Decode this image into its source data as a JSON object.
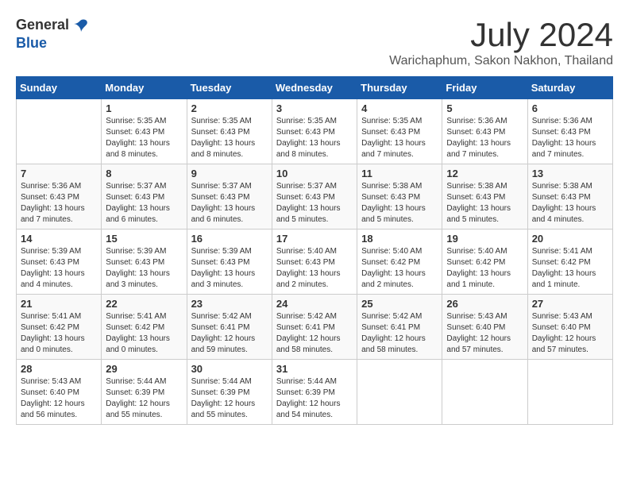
{
  "header": {
    "logo_line1": "General",
    "logo_line2": "Blue",
    "month": "July 2024",
    "location": "Warichaphum, Sakon Nakhon, Thailand"
  },
  "weekdays": [
    "Sunday",
    "Monday",
    "Tuesday",
    "Wednesday",
    "Thursday",
    "Friday",
    "Saturday"
  ],
  "weeks": [
    [
      {
        "day": "",
        "info": ""
      },
      {
        "day": "1",
        "info": "Sunrise: 5:35 AM\nSunset: 6:43 PM\nDaylight: 13 hours\nand 8 minutes."
      },
      {
        "day": "2",
        "info": "Sunrise: 5:35 AM\nSunset: 6:43 PM\nDaylight: 13 hours\nand 8 minutes."
      },
      {
        "day": "3",
        "info": "Sunrise: 5:35 AM\nSunset: 6:43 PM\nDaylight: 13 hours\nand 8 minutes."
      },
      {
        "day": "4",
        "info": "Sunrise: 5:35 AM\nSunset: 6:43 PM\nDaylight: 13 hours\nand 7 minutes."
      },
      {
        "day": "5",
        "info": "Sunrise: 5:36 AM\nSunset: 6:43 PM\nDaylight: 13 hours\nand 7 minutes."
      },
      {
        "day": "6",
        "info": "Sunrise: 5:36 AM\nSunset: 6:43 PM\nDaylight: 13 hours\nand 7 minutes."
      }
    ],
    [
      {
        "day": "7",
        "info": "Sunrise: 5:36 AM\nSunset: 6:43 PM\nDaylight: 13 hours\nand 7 minutes."
      },
      {
        "day": "8",
        "info": "Sunrise: 5:37 AM\nSunset: 6:43 PM\nDaylight: 13 hours\nand 6 minutes."
      },
      {
        "day": "9",
        "info": "Sunrise: 5:37 AM\nSunset: 6:43 PM\nDaylight: 13 hours\nand 6 minutes."
      },
      {
        "day": "10",
        "info": "Sunrise: 5:37 AM\nSunset: 6:43 PM\nDaylight: 13 hours\nand 5 minutes."
      },
      {
        "day": "11",
        "info": "Sunrise: 5:38 AM\nSunset: 6:43 PM\nDaylight: 13 hours\nand 5 minutes."
      },
      {
        "day": "12",
        "info": "Sunrise: 5:38 AM\nSunset: 6:43 PM\nDaylight: 13 hours\nand 5 minutes."
      },
      {
        "day": "13",
        "info": "Sunrise: 5:38 AM\nSunset: 6:43 PM\nDaylight: 13 hours\nand 4 minutes."
      }
    ],
    [
      {
        "day": "14",
        "info": "Sunrise: 5:39 AM\nSunset: 6:43 PM\nDaylight: 13 hours\nand 4 minutes."
      },
      {
        "day": "15",
        "info": "Sunrise: 5:39 AM\nSunset: 6:43 PM\nDaylight: 13 hours\nand 3 minutes."
      },
      {
        "day": "16",
        "info": "Sunrise: 5:39 AM\nSunset: 6:43 PM\nDaylight: 13 hours\nand 3 minutes."
      },
      {
        "day": "17",
        "info": "Sunrise: 5:40 AM\nSunset: 6:43 PM\nDaylight: 13 hours\nand 2 minutes."
      },
      {
        "day": "18",
        "info": "Sunrise: 5:40 AM\nSunset: 6:42 PM\nDaylight: 13 hours\nand 2 minutes."
      },
      {
        "day": "19",
        "info": "Sunrise: 5:40 AM\nSunset: 6:42 PM\nDaylight: 13 hours\nand 1 minute."
      },
      {
        "day": "20",
        "info": "Sunrise: 5:41 AM\nSunset: 6:42 PM\nDaylight: 13 hours\nand 1 minute."
      }
    ],
    [
      {
        "day": "21",
        "info": "Sunrise: 5:41 AM\nSunset: 6:42 PM\nDaylight: 13 hours\nand 0 minutes."
      },
      {
        "day": "22",
        "info": "Sunrise: 5:41 AM\nSunset: 6:42 PM\nDaylight: 13 hours\nand 0 minutes."
      },
      {
        "day": "23",
        "info": "Sunrise: 5:42 AM\nSunset: 6:41 PM\nDaylight: 12 hours\nand 59 minutes."
      },
      {
        "day": "24",
        "info": "Sunrise: 5:42 AM\nSunset: 6:41 PM\nDaylight: 12 hours\nand 58 minutes."
      },
      {
        "day": "25",
        "info": "Sunrise: 5:42 AM\nSunset: 6:41 PM\nDaylight: 12 hours\nand 58 minutes."
      },
      {
        "day": "26",
        "info": "Sunrise: 5:43 AM\nSunset: 6:40 PM\nDaylight: 12 hours\nand 57 minutes."
      },
      {
        "day": "27",
        "info": "Sunrise: 5:43 AM\nSunset: 6:40 PM\nDaylight: 12 hours\nand 57 minutes."
      }
    ],
    [
      {
        "day": "28",
        "info": "Sunrise: 5:43 AM\nSunset: 6:40 PM\nDaylight: 12 hours\nand 56 minutes."
      },
      {
        "day": "29",
        "info": "Sunrise: 5:44 AM\nSunset: 6:39 PM\nDaylight: 12 hours\nand 55 minutes."
      },
      {
        "day": "30",
        "info": "Sunrise: 5:44 AM\nSunset: 6:39 PM\nDaylight: 12 hours\nand 55 minutes."
      },
      {
        "day": "31",
        "info": "Sunrise: 5:44 AM\nSunset: 6:39 PM\nDaylight: 12 hours\nand 54 minutes."
      },
      {
        "day": "",
        "info": ""
      },
      {
        "day": "",
        "info": ""
      },
      {
        "day": "",
        "info": ""
      }
    ]
  ]
}
